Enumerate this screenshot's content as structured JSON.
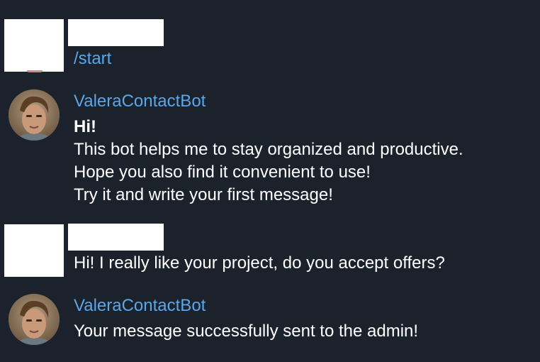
{
  "messages": [
    {
      "sender": "",
      "sender_redacted": true,
      "avatar": "redacted-avatar",
      "lines": [
        "/start"
      ],
      "is_command": true
    },
    {
      "sender": "ValeraContactBot",
      "avatar": "bot-avatar-photo",
      "lines": [
        "Hi!",
        "This bot helps me to stay organized and productive.",
        "Hope you also find it convenient to use!",
        "Try it and write your first message!"
      ]
    },
    {
      "sender": "",
      "sender_redacted": true,
      "avatar": "redacted-avatar",
      "lines": [
        "Hi! I really like your project, do you accept offers?"
      ]
    },
    {
      "sender": "ValeraContactBot",
      "avatar": "bot-avatar-photo",
      "lines": [
        "Your message successfully sent to the admin!"
      ]
    }
  ],
  "colors": {
    "background": "#1c222c",
    "link": "#5aa6ec",
    "text": "#ffffff"
  }
}
